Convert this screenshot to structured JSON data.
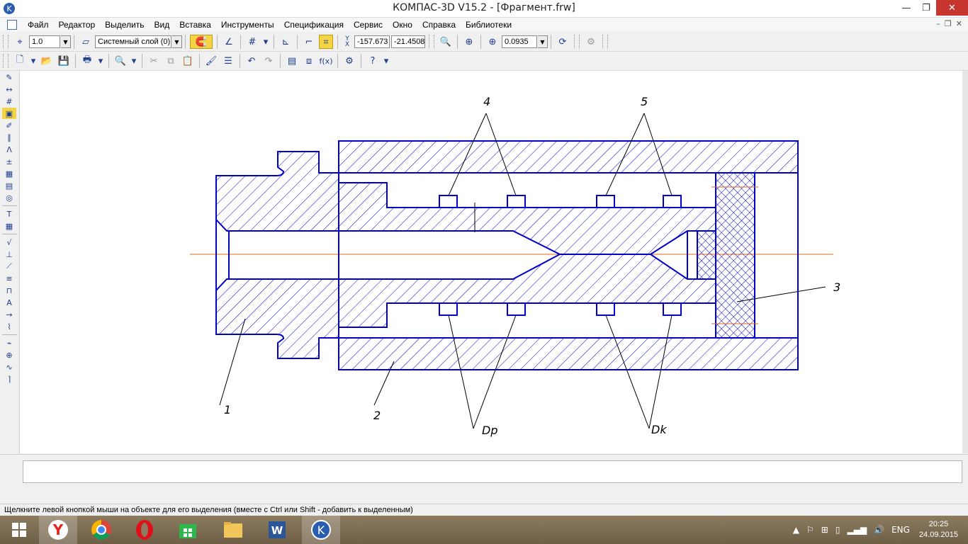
{
  "window": {
    "title": "КОМПАС-3D V15.2  - [Фрагмент.frw]",
    "min_glyph": "—",
    "max_glyph": "❐",
    "close_glyph": "✕"
  },
  "menu": [
    "Файл",
    "Редактор",
    "Выделить",
    "Вид",
    "Вставка",
    "Инструменты",
    "Спецификация",
    "Сервис",
    "Окно",
    "Справка",
    "Библиотеки"
  ],
  "mdi_controls": [
    "–",
    "❐",
    "✕"
  ],
  "toolbar1": {
    "step": "1.0",
    "layer": "Системный слой (0)",
    "x_label": "Y",
    "x_sub": "X",
    "coord_x": "-157.673",
    "coord_y": "-21.4508",
    "zoom": "0.0935"
  },
  "drawing": {
    "callouts": [
      "1",
      "2",
      "3",
      "4",
      "5",
      "Dp",
      "Dk"
    ],
    "line_color": "#0000c8",
    "axis_color": "#e06a10"
  },
  "status": {
    "hint": "Щелкните левой кнопкой мыши на объекте для его выделения (вместе с Ctrl или Shift - добавить к выделенным)"
  },
  "taskbar": {
    "lang": "ENG",
    "time": "20:25",
    "date": "24.09.2015"
  }
}
